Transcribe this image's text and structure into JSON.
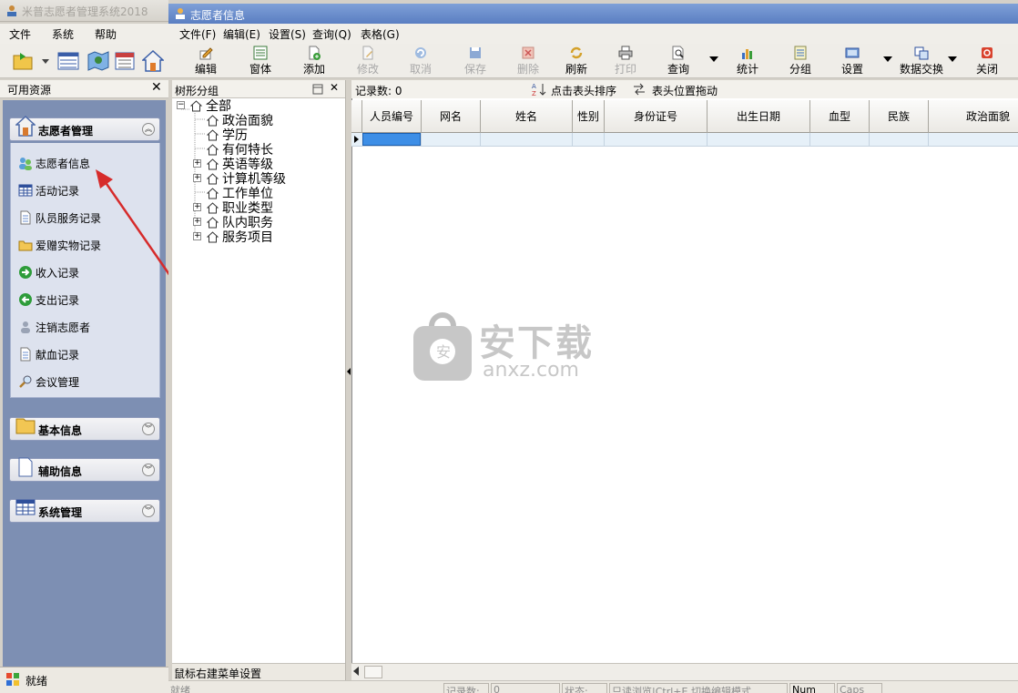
{
  "outer": {
    "title": "米普志愿者管理系统2018",
    "menu": [
      "文件",
      "系统",
      "帮助"
    ],
    "resources_label": "可用资源",
    "close_glyph": "✕",
    "panels": {
      "volunteer": {
        "title": "志愿者管理",
        "chevron": "︽"
      },
      "basic": {
        "title": "基本信息",
        "chevron": "︾"
      },
      "aux": {
        "title": "辅助信息",
        "chevron": "︾"
      },
      "sys": {
        "title": "系统管理",
        "chevron": "︾"
      }
    },
    "nav_items": [
      {
        "label": "志愿者信息",
        "icon": "people-icon"
      },
      {
        "label": "活动记录",
        "icon": "table-icon"
      },
      {
        "label": "队员服务记录",
        "icon": "document-icon"
      },
      {
        "label": "爱赠实物记录",
        "icon": "open-folder-icon"
      },
      {
        "label": "收入记录",
        "icon": "arrow-right-icon"
      },
      {
        "label": "支出记录",
        "icon": "arrow-left-icon"
      },
      {
        "label": "注销志愿者",
        "icon": "person-remove-icon"
      },
      {
        "label": "献血记录",
        "icon": "document-icon"
      },
      {
        "label": "会议管理",
        "icon": "magnifier-icon"
      }
    ],
    "status": "就绪"
  },
  "inner": {
    "title": "志愿者信息",
    "menu": [
      "文件(F)",
      "编辑(E)",
      "设置(S)",
      "查询(Q)",
      "表格(G)"
    ],
    "toolbar": [
      {
        "label": "编辑",
        "icon": "edit-icon",
        "enabled": true
      },
      {
        "label": "窗体",
        "icon": "form-icon",
        "enabled": true
      },
      {
        "label": "添加",
        "icon": "add-icon",
        "enabled": true
      },
      {
        "label": "修改",
        "icon": "modify-icon",
        "enabled": false
      },
      {
        "label": "取消",
        "icon": "undo-icon",
        "enabled": false
      },
      {
        "label": "保存",
        "icon": "save-icon",
        "enabled": false
      },
      {
        "label": "删除",
        "icon": "delete-icon",
        "enabled": false
      },
      {
        "label": "刷新",
        "icon": "refresh-icon",
        "enabled": true
      },
      {
        "label": "打印",
        "icon": "printer-icon",
        "enabled": false
      },
      {
        "label": "查询",
        "icon": "query-icon",
        "enabled": true
      },
      {
        "label": "统计",
        "icon": "chart-icon",
        "enabled": true
      },
      {
        "label": "分组",
        "icon": "group-icon",
        "enabled": true
      },
      {
        "label": "设置",
        "icon": "settings-icon",
        "enabled": true
      },
      {
        "label": "数据交换",
        "icon": "exchange-icon",
        "enabled": true
      },
      {
        "label": "关闭",
        "icon": "close-icon",
        "enabled": true
      }
    ],
    "tree": {
      "header": "树形分组",
      "root": "全部",
      "nodes": [
        {
          "label": "政治面貌",
          "expandable": false
        },
        {
          "label": "学历",
          "expandable": false
        },
        {
          "label": "有何特长",
          "expandable": false
        },
        {
          "label": "英语等级",
          "expandable": true
        },
        {
          "label": "计算机等级",
          "expandable": true
        },
        {
          "label": "工作单位",
          "expandable": false
        },
        {
          "label": "职业类型",
          "expandable": true
        },
        {
          "label": "队内职务",
          "expandable": true
        },
        {
          "label": "服务项目",
          "expandable": true
        }
      ],
      "footer": "鼠标右建菜单设置"
    },
    "grid": {
      "record_count": "记录数: 0",
      "sort_hint": "点击表头排序",
      "drag_hint": "表头位置拖动",
      "columns": [
        "人员编号",
        "网名",
        "姓名",
        "性别",
        "身份证号",
        "出生日期",
        "血型",
        "民族",
        "政治面貌"
      ]
    },
    "statusbar": [
      "就绪",
      "记录数:",
      "0",
      "状态:",
      "只读浏览|Ctrl+E 切换编辑模式",
      "Num",
      "Caps"
    ]
  },
  "watermark": {
    "text": "安下载",
    "sub": "anxz.com"
  },
  "colors": {
    "nav_bg": "#7d8fb3",
    "title_blue": "#5a7ec2",
    "row_select": "#3d8ee6",
    "annotation_arrow": "#d62b2b"
  }
}
